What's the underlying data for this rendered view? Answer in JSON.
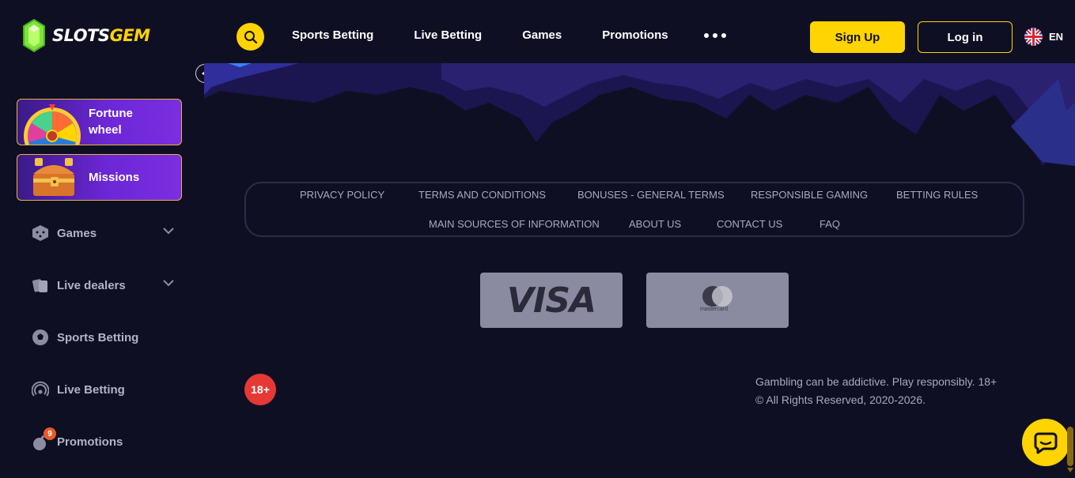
{
  "brand": {
    "name_part1": "SLOTS",
    "name_part2": "GEM",
    "accent": "#ffd400"
  },
  "header": {
    "nav": [
      "Sports Betting",
      "Live Betting",
      "Games",
      "Promotions"
    ],
    "more_icon": "more-dots-icon",
    "signup_label": "Sign Up",
    "login_label": "Log in",
    "language": "EN"
  },
  "sidebar": {
    "promos": [
      {
        "label_line1": "Fortune",
        "label_line2": "wheel",
        "icon": "fortune-wheel-icon"
      },
      {
        "label_line1": "Missions",
        "icon": "treasure-chest-icon"
      }
    ],
    "items": [
      {
        "label": "Games",
        "icon": "dice-icon",
        "expandable": true
      },
      {
        "label": "Live dealers",
        "icon": "cards-icon",
        "expandable": true
      },
      {
        "label": "Sports Betting",
        "icon": "soccer-ball-icon",
        "expandable": false
      },
      {
        "label": "Live Betting",
        "icon": "broadcast-icon",
        "expandable": false
      },
      {
        "label": "Promotions",
        "icon": "bomb-icon",
        "expandable": false,
        "badge": "9"
      }
    ]
  },
  "footer": {
    "links_row1": [
      "PRIVACY POLICY",
      "TERMS AND CONDITIONS",
      "BONUSES - GENERAL TERMS",
      "RESPONSIBLE GAMING",
      "BETTING RULES"
    ],
    "links_row2": [
      "MAIN SOURCES OF INFORMATION",
      "ABOUT US",
      "CONTACT US",
      "FAQ"
    ],
    "payments": [
      "VISA",
      "mastercard"
    ],
    "age_badge": "18+",
    "legal_line1": "Gambling can be addictive. Play responsibly. 18+",
    "legal_line2": "© All Rights Reserved, 2020-2026."
  }
}
